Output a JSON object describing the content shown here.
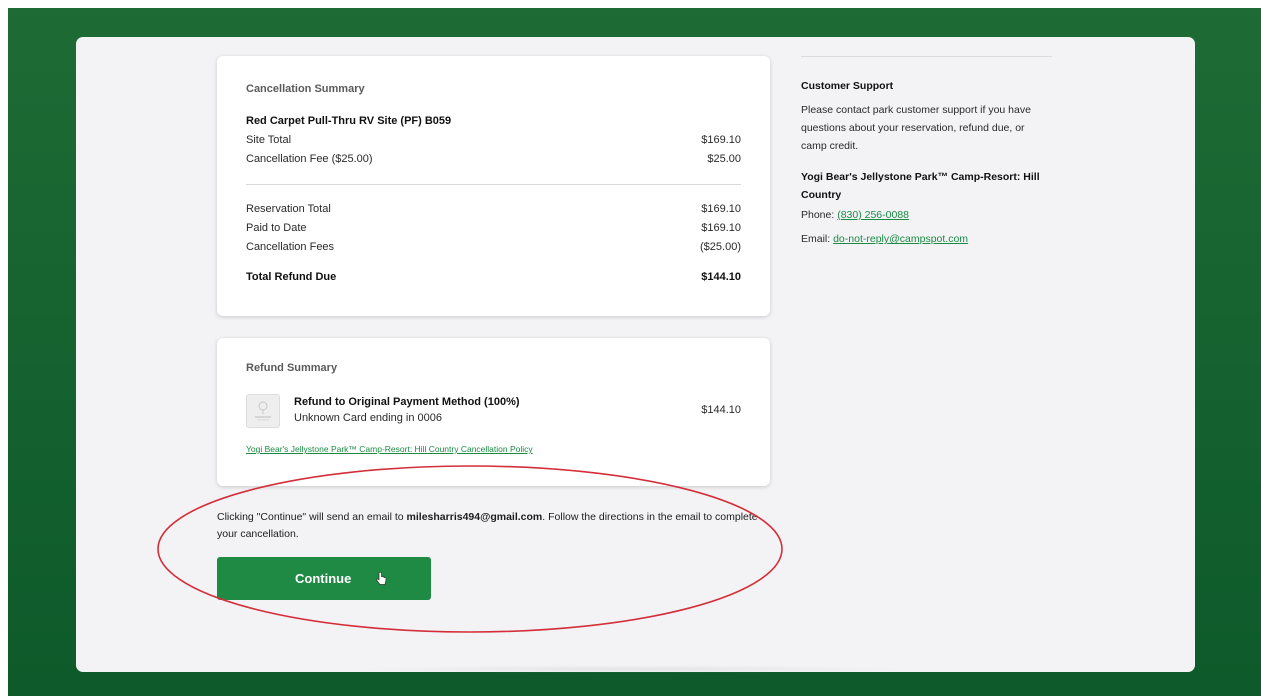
{
  "summary": {
    "title": "Cancellation Summary",
    "site_name": "Red Carpet Pull-Thru RV Site (PF) B059",
    "site_total_label": "Site Total",
    "site_total_amount": "$169.10",
    "cancel_fee_label": "Cancellation Fee ($25.00)",
    "cancel_fee_amount": "$25.00",
    "reservation_total_label": "Reservation Total",
    "reservation_total_amount": "$169.10",
    "paid_to_date_label": "Paid to Date",
    "paid_to_date_amount": "$169.10",
    "cancellation_fees_label": "Cancellation Fees",
    "cancellation_fees_amount": "($25.00)",
    "total_refund_label": "Total Refund Due",
    "total_refund_amount": "$144.10"
  },
  "refund": {
    "title": "Refund Summary",
    "method_title": "Refund to Original Payment Method (100%)",
    "card_text": "Unknown Card ending in 0006",
    "amount": "$144.10",
    "policy_link": "Yogi Bear's Jellystone Park™ Camp-Resort: Hill Country Cancellation Policy"
  },
  "notice": {
    "prefix": "Clicking \"Continue\" will send an email to ",
    "email": "milesharris494@gmail.com",
    "suffix": ". Follow the directions in the email to complete your cancellation."
  },
  "continue_button": {
    "label": "Continue"
  },
  "support": {
    "title": "Customer Support",
    "text": "Please contact park customer support if you have questions about your reservation, refund due, or camp credit.",
    "park_name": "Yogi Bear's Jellystone Park™ Camp-Resort: Hill Country",
    "phone_label": "Phone: ",
    "phone": "(830) 256-0088",
    "email_label": "Email: ",
    "email": "do-not-reply@campspot.com"
  },
  "colors": {
    "accent": "#1f8a44",
    "background": "#1f6b35",
    "annotation": "#d32f3a"
  },
  "icons": {
    "card": "card-placeholder-icon",
    "cursor": "hand-pointer-icon"
  }
}
